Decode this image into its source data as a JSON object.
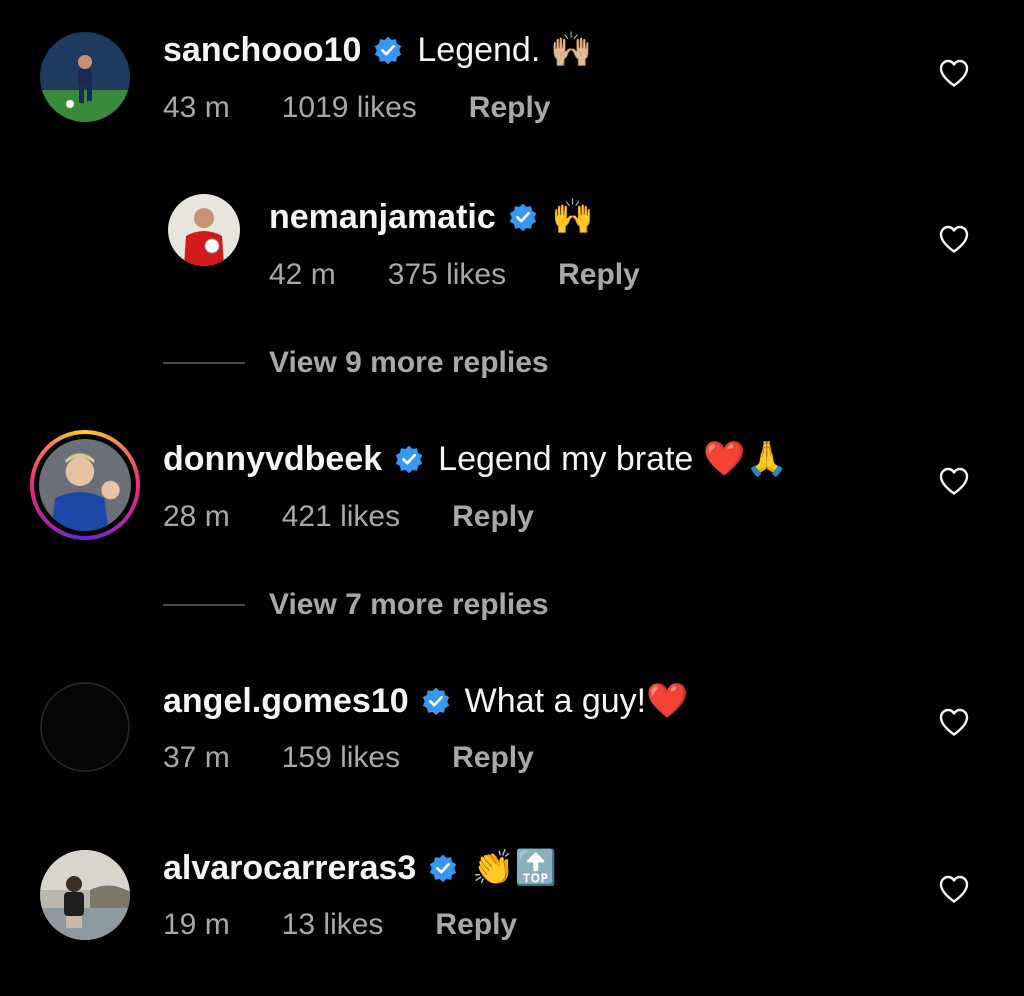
{
  "comments": [
    {
      "username": "sanchooo10",
      "text": "Legend.",
      "emoji": "🙌🏼",
      "time": "43 m",
      "likes": "1019 likes",
      "reply_label": "Reply",
      "replies": [
        {
          "username": "nemanjamatic",
          "text": "",
          "emoji": "🙌",
          "time": "42 m",
          "likes": "375 likes",
          "reply_label": "Reply"
        }
      ],
      "view_more": "View 9 more replies"
    },
    {
      "username": "donnyvdbeek",
      "text": "Legend my brate",
      "emoji": "❤️🙏",
      "time": "28 m",
      "likes": "421 likes",
      "reply_label": "Reply",
      "view_more": "View 7 more replies"
    },
    {
      "username": "angel.gomes10",
      "text": "What a guy!",
      "emoji": "❤️",
      "time": "37 m",
      "likes": "159 likes",
      "reply_label": "Reply"
    },
    {
      "username": "alvarocarreras3",
      "text": "",
      "emoji": "👏🔝",
      "time": "19 m",
      "likes": "13 likes",
      "reply_label": "Reply"
    }
  ],
  "colors": {
    "background": "#000000",
    "primary_text": "#f5f5f5",
    "secondary_text": "#a8a8a8",
    "verified_blue": "#3897f0"
  },
  "icons": {
    "verified": "verified-badge-icon",
    "like": "heart-outline-icon"
  }
}
